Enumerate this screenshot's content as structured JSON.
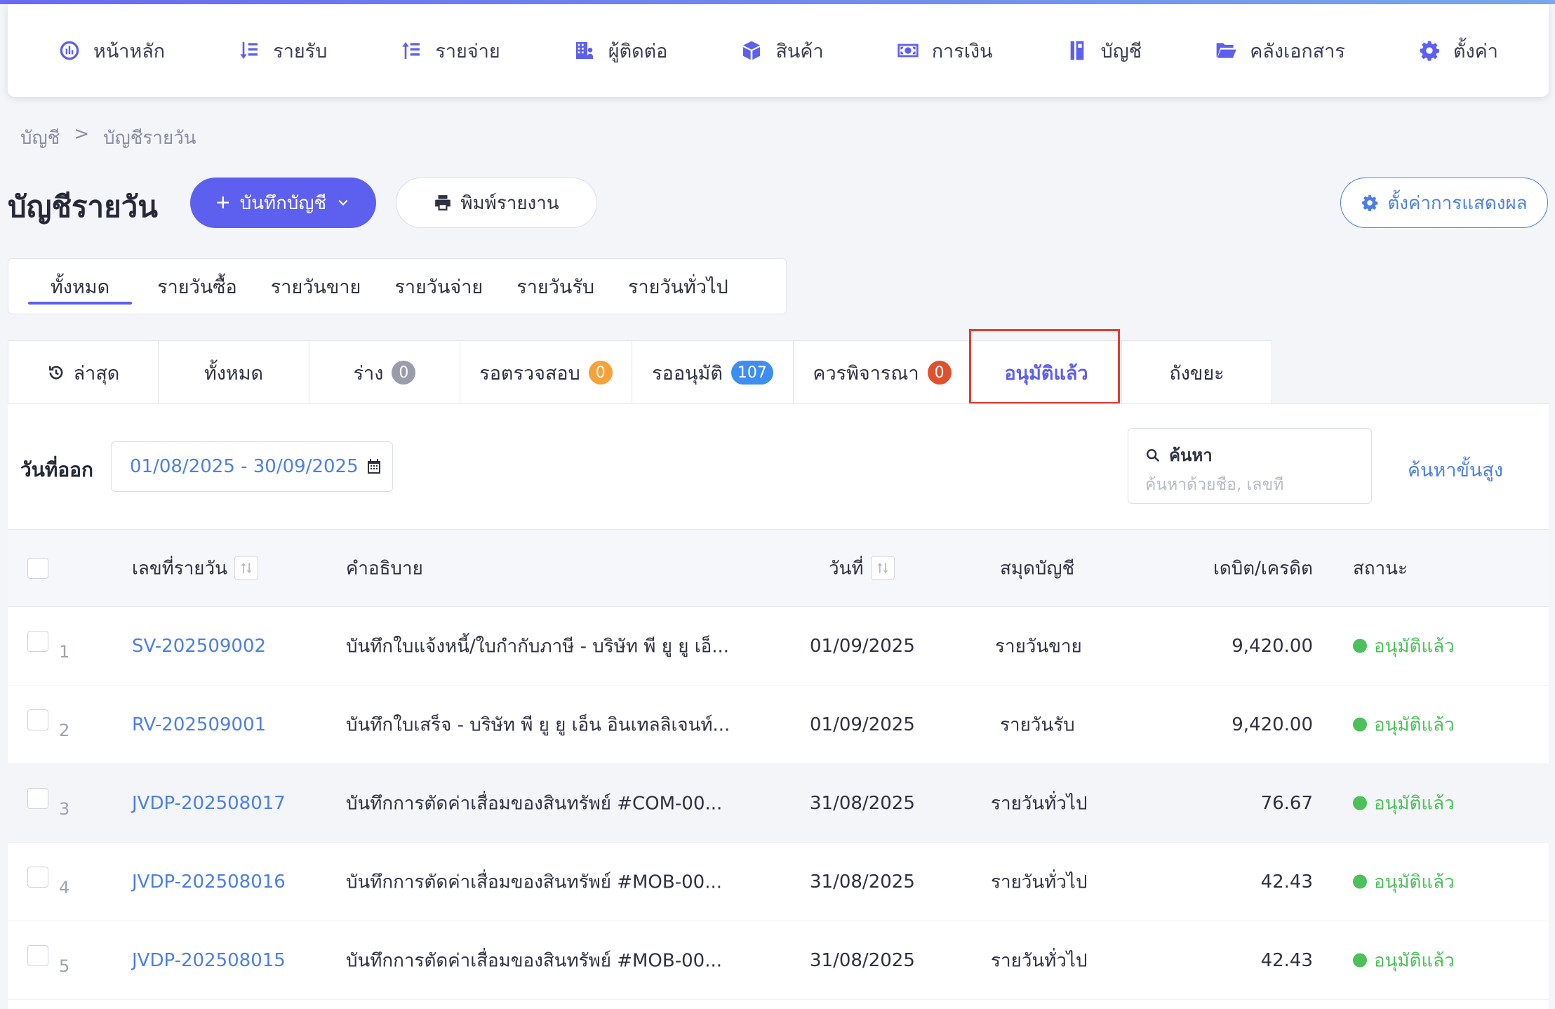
{
  "nav": [
    {
      "label": "หน้าหลัก",
      "icon": "dashboard-icon"
    },
    {
      "label": "รายรับ",
      "icon": "income-icon"
    },
    {
      "label": "รายจ่าย",
      "icon": "expense-icon"
    },
    {
      "label": "ผู้ติดต่อ",
      "icon": "contacts-icon"
    },
    {
      "label": "สินค้า",
      "icon": "box-icon"
    },
    {
      "label": "การเงิน",
      "icon": "money-icon"
    },
    {
      "label": "บัญชี",
      "icon": "ledger-book-icon"
    },
    {
      "label": "คลังเอกสาร",
      "icon": "folder-icon"
    },
    {
      "label": "ตั้งค่า",
      "icon": "gear-icon"
    }
  ],
  "breadcrumb": {
    "root": "บัญชี",
    "separator": ">",
    "current": "บัญชีรายวัน"
  },
  "page_title": "บัญชีรายวัน",
  "buttons": {
    "record": "บันทึกบัญชี",
    "print": "พิมพ์รายงาน",
    "display_settings": "ตั้งค่าการแสดงผล"
  },
  "journal_tabs": [
    "ทั้งหมด",
    "รายวันซื้อ",
    "รายวันขาย",
    "รายวันจ่าย",
    "รายวันรับ",
    "รายวันทั่วไป"
  ],
  "journal_tab_active": 0,
  "status_tabs": [
    {
      "label": "ล่าสุด",
      "badge": null
    },
    {
      "label": "ทั้งหมด",
      "badge": null
    },
    {
      "label": "ร่าง",
      "badge": "0",
      "badge_color": "#9a9cab"
    },
    {
      "label": "รอตรวจสอบ",
      "badge": "0",
      "badge_color": "#f5a23a"
    },
    {
      "label": "รออนุมัติ",
      "badge": "107",
      "badge_color": "#3d8ef0"
    },
    {
      "label": "ควรพิจารณา",
      "badge": "0",
      "badge_color": "#e0502f"
    },
    {
      "label": "อนุมัติแล้ว",
      "badge": null
    },
    {
      "label": "ถังขยะ",
      "badge": null
    }
  ],
  "status_tab_active": 6,
  "filter": {
    "label": "วันที่ออก",
    "date_range": "01/08/2025 - 30/09/2025"
  },
  "search": {
    "label": "ค้นหา",
    "placeholder": "ค้นหาด้วยชื่อ, เลขที่"
  },
  "advanced_search": "ค้นหาขั้นสูง",
  "table": {
    "headers": {
      "number": "เลขที่รายวัน",
      "description": "คำอธิบาย",
      "date": "วันที่",
      "book": "สมุดบัญชี",
      "amount": "เดบิต/เครดิต",
      "status": "สถานะ"
    },
    "rows": [
      {
        "idx": "1",
        "number": "SV-202509002",
        "description": "บันทึกใบแจ้งหนี้/ใบกำกับภาษี - บริษัท พี ยู ยู เอ็...",
        "date": "01/09/2025",
        "book": "รายวันขาย",
        "amount": "9,420.00",
        "status": "อนุมัติแล้ว"
      },
      {
        "idx": "2",
        "number": "RV-202509001",
        "description": "บันทึกใบเสร็จ - บริษัท พี ยู ยู เอ็น อินเทลลิเจนท์...",
        "date": "01/09/2025",
        "book": "รายวันรับ",
        "amount": "9,420.00",
        "status": "อนุมัติแล้ว"
      },
      {
        "idx": "3",
        "number": "JVDP-202508017",
        "description": "บันทึกการตัดค่าเสื่อมของสินทรัพย์ #COM-00...",
        "date": "31/08/2025",
        "book": "รายวันทั่วไป",
        "amount": "76.67",
        "status": "อนุมัติแล้ว"
      },
      {
        "idx": "4",
        "number": "JVDP-202508016",
        "description": "บันทึกการตัดค่าเสื่อมของสินทรัพย์ #MOB-00...",
        "date": "31/08/2025",
        "book": "รายวันทั่วไป",
        "amount": "42.43",
        "status": "อนุมัติแล้ว"
      },
      {
        "idx": "5",
        "number": "JVDP-202508015",
        "description": "บันทึกการตัดค่าเสื่อมของสินทรัพย์ #MOB-00...",
        "date": "31/08/2025",
        "book": "รายวันทั่วไป",
        "amount": "42.43",
        "status": "อนุมัติแล้ว"
      }
    ]
  }
}
